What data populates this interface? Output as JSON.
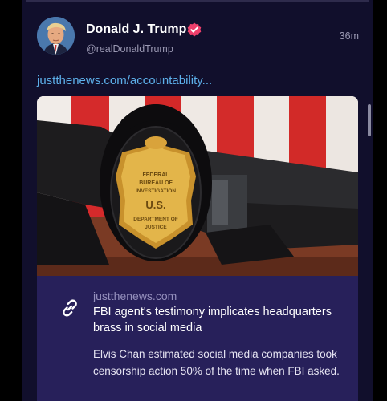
{
  "post": {
    "author_name": "Donald J. Trump",
    "handle": "@realDonaldTrump",
    "timestamp": "36m",
    "link_text": "justthenews.com/accountability...",
    "verified": true
  },
  "link_card": {
    "domain": "justthenews.com",
    "title": "FBI agent's testimony implicates headquarters brass in social media",
    "description": "Elvis Chan estimated social media companies took censorship action 50% of the time when FBI asked.",
    "image_badge_text": [
      "FEDERAL",
      "BUREAU OF",
      "INVESTIGATION",
      "U.S.",
      "DEPARTMENT OF",
      "JUSTICE"
    ]
  },
  "icons": {
    "verified": "verified-badge-icon",
    "link": "link-icon"
  },
  "colors": {
    "background": "#000000",
    "column": "#110f2c",
    "card_body": "#27205a",
    "link": "#5db0ea",
    "verified_badge": "#ee3f6b",
    "muted_text": "#9b99b3"
  }
}
